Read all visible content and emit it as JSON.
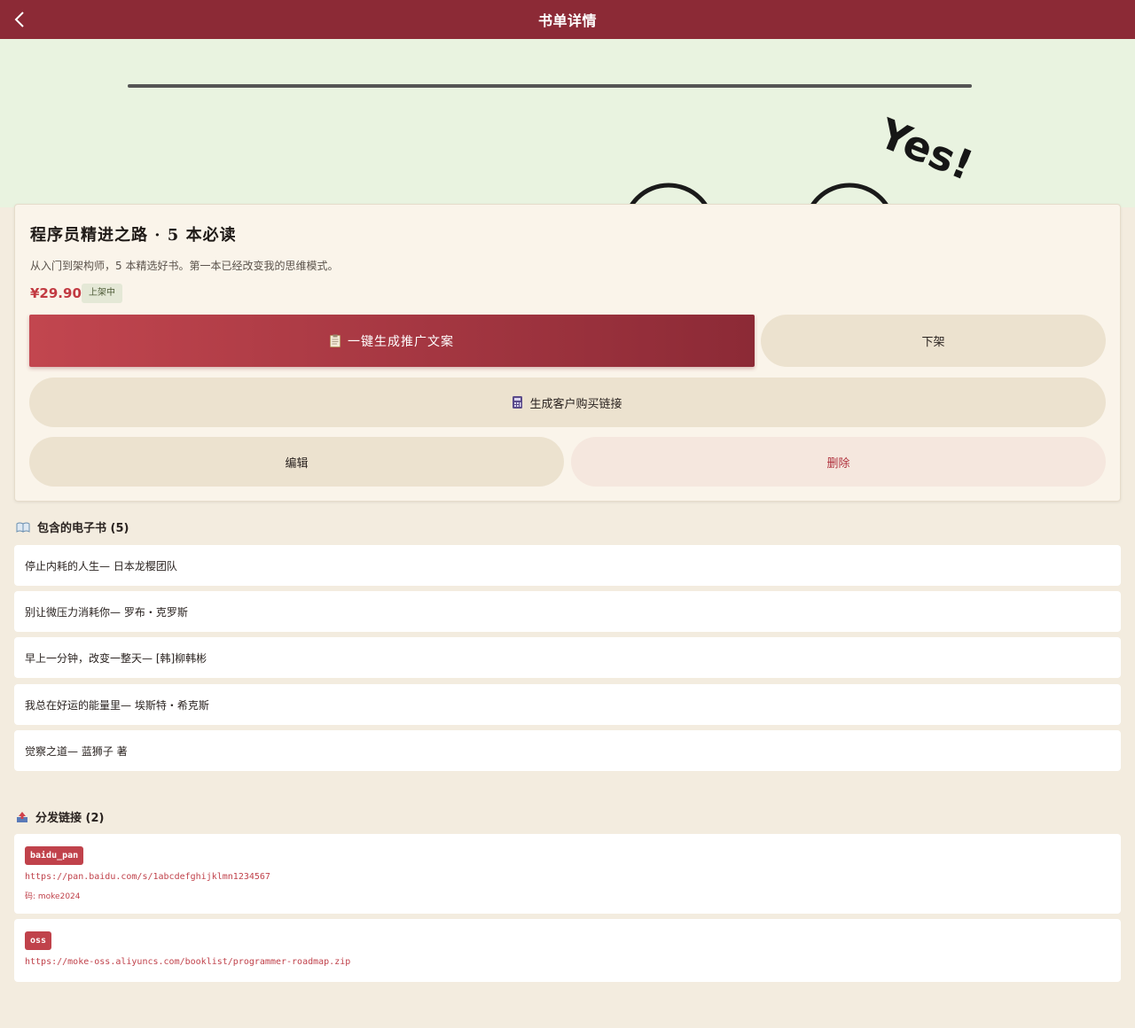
{
  "header": {
    "title": "书单详情",
    "back_icon": "chevron-left-icon"
  },
  "hero": {
    "image_text": "Yes!"
  },
  "booklist": {
    "title": "程序员精进之路 · 5 本必读",
    "description": "从入门到架构师，5 本精选好书。第一本已经改变我的思维模式。",
    "price": "¥29.90",
    "status": "上架中"
  },
  "actions": {
    "promo_label": "一键生成推广文案",
    "promo_icon": "clipboard-icon",
    "offshelf_label": "下架",
    "link_label": "生成客户购买链接",
    "link_icon": "calculator-icon",
    "edit_label": "编辑",
    "delete_label": "删除"
  },
  "books": {
    "heading": "包含的电子书 (5)",
    "icon": "open-book-icon",
    "items": [
      "停止内耗的人生— 日本龙樱团队",
      "别让微压力消耗你— 罗布・克罗斯",
      "早上一分钟，改变一整天— [韩]柳韩彬",
      "我总在好运的能量里— 埃斯特・希克斯",
      "觉察之道— 蓝狮子 著"
    ]
  },
  "links": {
    "heading": "分发链接 (2)",
    "icon": "outbox-tray-icon",
    "items": [
      {
        "type": "baidu_pan",
        "url": "https://pan.baidu.com/s/1abcdefghijklmn1234567",
        "code": "码: moke2024"
      },
      {
        "type": "oss",
        "url": "https://moke-oss.aliyuncs.com/booklist/programmer-roadmap.zip"
      }
    ]
  },
  "colors": {
    "brand": "#8c2a36",
    "accent": "#c0424b",
    "background": "#f3ecdf"
  }
}
